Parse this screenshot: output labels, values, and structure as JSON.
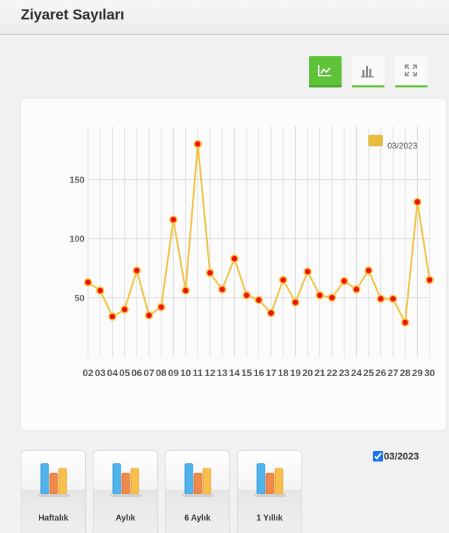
{
  "header": {
    "title": "Ziyaret Sayıları"
  },
  "toolbar": {
    "line_icon": "line-chart-icon",
    "bar_icon": "bar-chart-icon",
    "fullscreen_icon": "fullscreen-icon",
    "active": "line"
  },
  "colors": {
    "accent_green": "#5fc33a",
    "line": "#f0c340",
    "marker_fill": "#ee1111",
    "legend_swatch": "#e9bd3c"
  },
  "chart_data": {
    "type": "line",
    "categories": [
      "02",
      "03",
      "04",
      "05",
      "06",
      "07",
      "08",
      "09",
      "10",
      "11",
      "12",
      "13",
      "14",
      "15",
      "16",
      "17",
      "18",
      "19",
      "20",
      "21",
      "22",
      "23",
      "24",
      "25",
      "26",
      "27",
      "28",
      "29",
      "30"
    ],
    "series": [
      {
        "name": "03/2023",
        "values": [
          63,
          56,
          34,
          40,
          73,
          35,
          42,
          116,
          56,
          180,
          71,
          57,
          83,
          52,
          48,
          37,
          65,
          46,
          72,
          52,
          50,
          64,
          57,
          73,
          49,
          49,
          29,
          131,
          65
        ]
      }
    ],
    "yticks": [
      50,
      100,
      150
    ],
    "ylim": [
      0,
      195
    ],
    "grid": true,
    "legend": "top-right"
  },
  "series_toggle": {
    "label": "03/2023",
    "checked": true
  },
  "periods": [
    {
      "label": "Haftalık"
    },
    {
      "label": "Aylık"
    },
    {
      "label": "6 Aylık"
    },
    {
      "label": "1 Yıllık"
    }
  ]
}
